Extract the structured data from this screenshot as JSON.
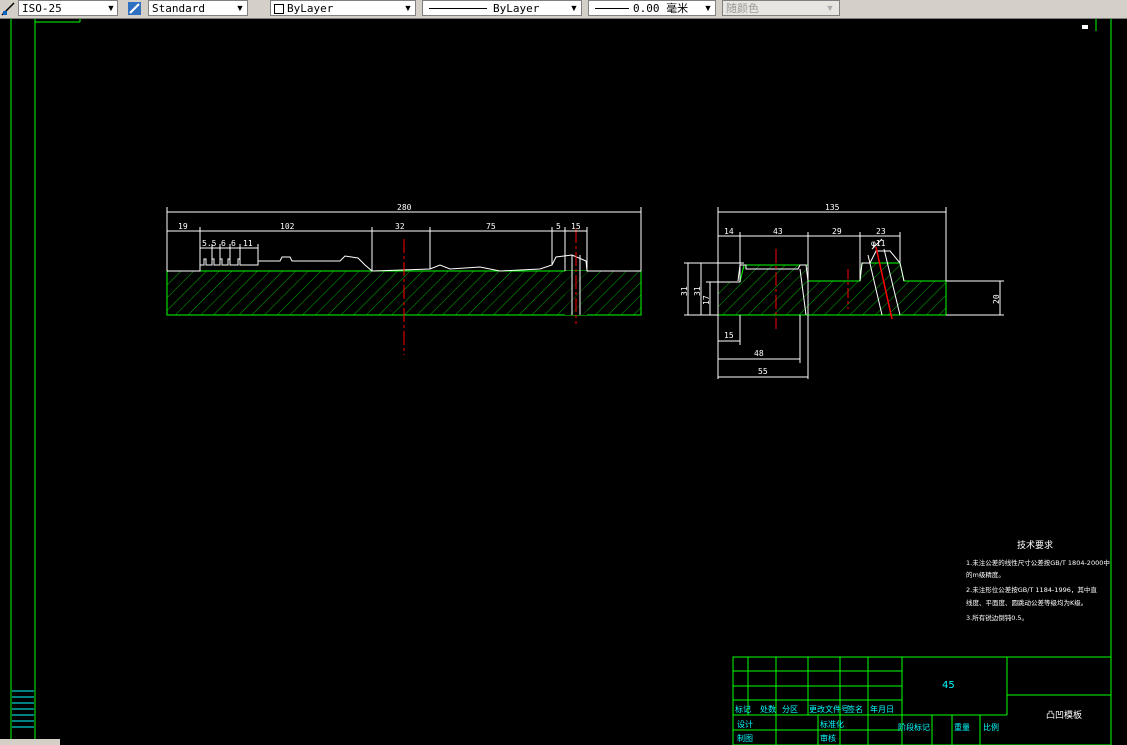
{
  "toolbar": {
    "dimstyle": "ISO-25",
    "textstyle": "Standard",
    "layer": "ByLayer",
    "linetype": "ByLayer",
    "lineweight": "0.00 毫米",
    "color": "随颜色"
  },
  "drawing": {
    "dims_left": [
      "280",
      "19",
      "102",
      "5.5",
      "6",
      "6",
      "11",
      "32",
      "75",
      "5",
      "15"
    ],
    "dims_right": [
      "135",
      "14",
      "43",
      "29",
      "23",
      "31",
      "31",
      "17",
      "20",
      "15",
      "48",
      "55"
    ],
    "dia_label": "φ11",
    "tech_title": "技术要求",
    "tech_lines": [
      "1.未注公差的线性尺寸公差按GB/T 1804-2000中",
      "  的m级精度。",
      "2.未注形位公差按GB/T 1184-1996，其中直",
      "  线度、平面度、圆跳动公差等级均为K级。",
      "3.所有锐边倒钝0.5。"
    ],
    "material": "45",
    "part_name": "凸凹模板",
    "tb_row1": [
      "标记",
      "处数",
      "分区",
      "更改文件号",
      "签名",
      "年月日"
    ],
    "tb_design": "设计",
    "tb_std": "标准化",
    "tb_draw": "制图",
    "tb_review": "审核",
    "tb_right": [
      "阶段标记",
      "重量",
      "比例"
    ]
  },
  "colors": {
    "frame": "#00ff00",
    "dim": "#ffffff",
    "center": "#ff0000",
    "cyan": "#00ffff",
    "hatch": "#00c000"
  }
}
